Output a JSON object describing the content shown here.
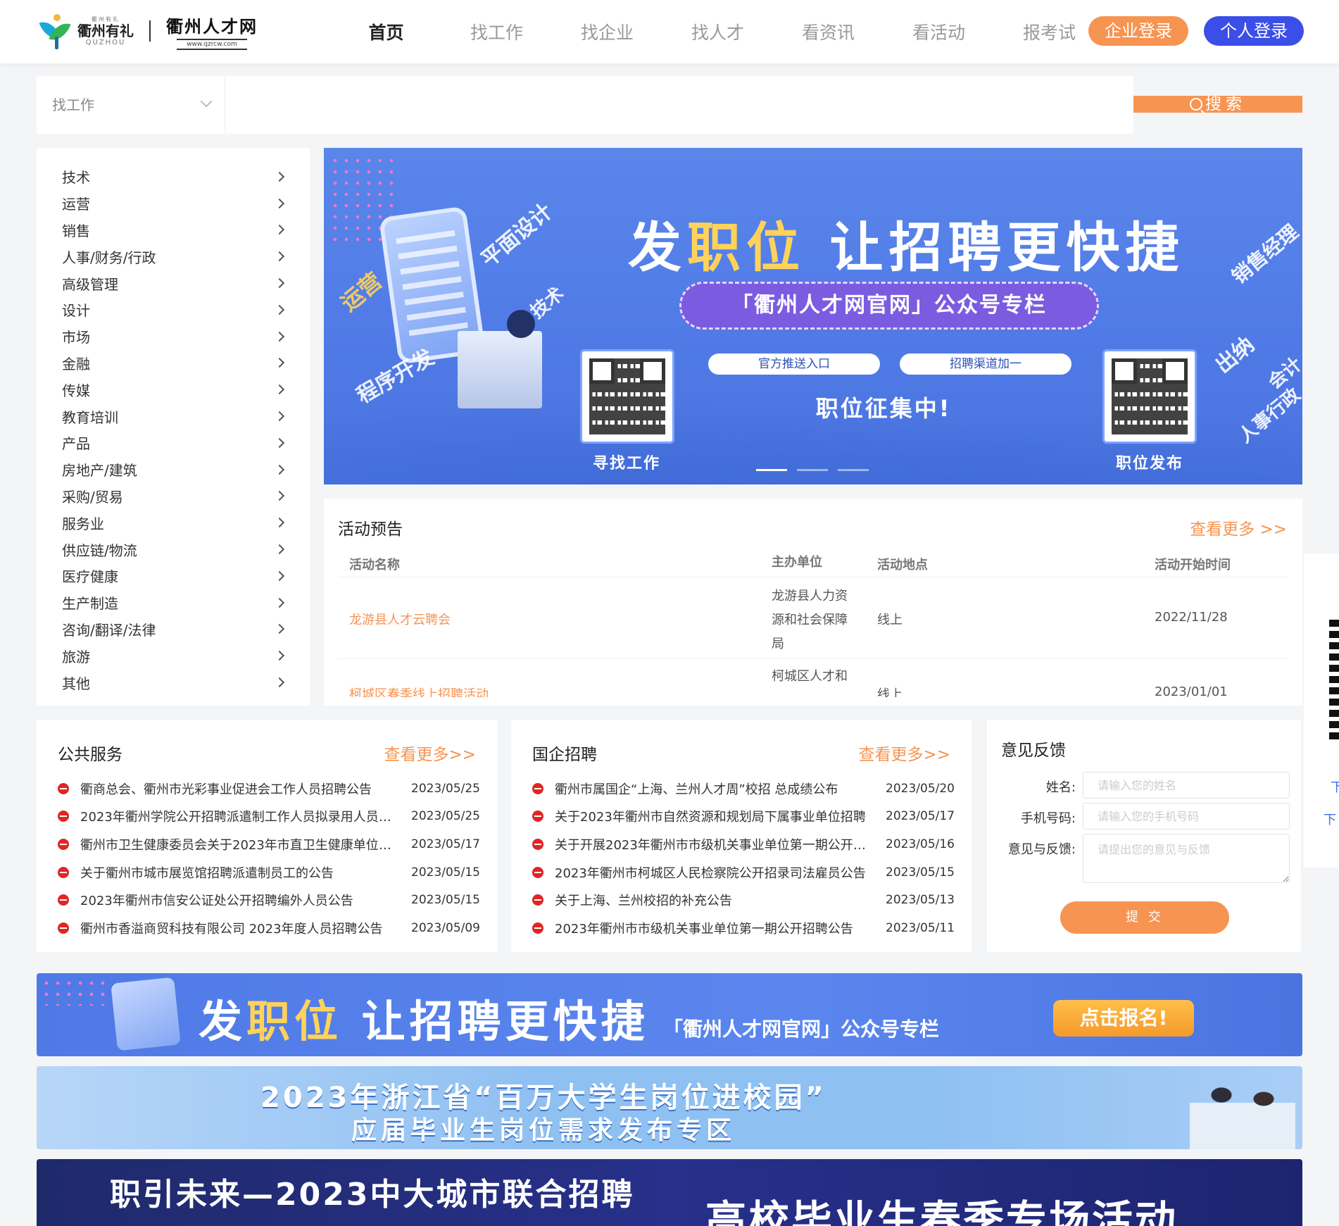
{
  "header": {
    "logo_small": "衢州有礼",
    "logo_brand": "衢州有礼",
    "logo_en": "QUZHOU",
    "site_name": "衢州人才网",
    "site_url": "www.qzrcw.com",
    "nav": [
      "首页",
      "找工作",
      "找企业",
      "找人才",
      "看资讯",
      "看活动",
      "报考试"
    ],
    "company_login": "企业登录",
    "personal_login": "个人登录"
  },
  "search": {
    "category": "找工作",
    "placeholder": "",
    "button": "搜索"
  },
  "sidebar": {
    "items": [
      "技术",
      "运营",
      "销售",
      "人事/财务/行政",
      "高级管理",
      "设计",
      "市场",
      "金融",
      "传媒",
      "教育培训",
      "产品",
      "房地产/建筑",
      "采购/贸易",
      "服务业",
      "供应链/物流",
      "医疗健康",
      "生产制造",
      "咨询/翻译/法律",
      "旅游",
      "其他"
    ]
  },
  "banner": {
    "title_pre": "发",
    "title_hl": "职位",
    "title_post": "让招聘更快捷",
    "pill": "「衢州人才网官网」公众号专栏",
    "tag1": "官方推送入口",
    "tag2": "招聘渠道加一",
    "collect": "职位征集中!",
    "qr1_label": "寻找工作",
    "qr2_label": "职位发布",
    "deco_words": [
      "平面设计",
      "运营",
      "技术",
      "程序开发",
      "销售经理",
      "出纳",
      "会计",
      "人事行政"
    ]
  },
  "activity": {
    "title": "活动预告",
    "more": "查看更多 >>",
    "headers": {
      "name": "活动名称",
      "org": "主办单位",
      "place": "活动地点",
      "time": "活动开始时间"
    },
    "rows": [
      {
        "name": "龙游县人才云聘会",
        "org": "龙游县人力资源和社会保障局",
        "place": "线上",
        "time": "2022/11/28"
      },
      {
        "name": "柯城区春季线上招聘活动",
        "org": "柯城区人才和",
        "place": "线上",
        "time": "2023/01/01"
      }
    ]
  },
  "public_service": {
    "title": "公共服务",
    "more": "查看更多>>",
    "items": [
      {
        "title": "衢商总会、衢州市光彩事业促进会工作人员招聘公告",
        "date": "2023/05/25"
      },
      {
        "title": "2023年衢州学院公开招聘派遣制工作人员拟录用人员公示",
        "date": "2023/05/25"
      },
      {
        "title": "衢州市卫生健康委员会关于2023年市直卫生健康单位公开招聘",
        "date": "2023/05/17"
      },
      {
        "title": "关于衢州市城市展览馆招聘派遣制员工的公告",
        "date": "2023/05/15"
      },
      {
        "title": "2023年衢州市信安公证处公开招聘编外人员公告",
        "date": "2023/05/15"
      },
      {
        "title": "衢州市香溢商贸科技有限公司 2023年度人员招聘公告",
        "date": "2023/05/09"
      }
    ]
  },
  "soe": {
    "title": "国企招聘",
    "more": "查看更多>>",
    "items": [
      {
        "title": "衢州市属国企“上海、兰州人才周”校招 总成绩公布",
        "date": "2023/05/20"
      },
      {
        "title": "关于2023年衢州市自然资源和规划局下属事业单位招聘",
        "date": "2023/05/17"
      },
      {
        "title": "关于开展2023年衢州市市级机关事业单位第一期公开招聘",
        "date": "2023/05/16"
      },
      {
        "title": "2023年衢州市柯城区人民检察院公开招录司法雇员公告",
        "date": "2023/05/15"
      },
      {
        "title": "关于上海、兰州校招的补充公告",
        "date": "2023/05/13"
      },
      {
        "title": "2023年衢州市市级机关事业单位第一期公开招聘公告",
        "date": "2023/05/11"
      }
    ]
  },
  "feedback": {
    "title": "意见反馈",
    "name_label": "姓名:",
    "name_placeholder": "请输入您的姓名",
    "phone_label": "手机号码:",
    "phone_placeholder": "请输入您的手机号码",
    "opinion_label": "意见与反馈:",
    "opinion_placeholder": "请提出您的意见与反馈",
    "submit": "提 交"
  },
  "float_side": {
    "text1": "下",
    "text2": "下"
  },
  "bottom_banners": {
    "b1_pre": "发",
    "b1_hl": "职位",
    "b1_post": "让招聘更快捷",
    "b1_sub": "「衢州人才网官网」公众号专栏",
    "b1_cta": "点击报名!",
    "b2_line1": "2023年浙江省“百万大学生岗位进校园”",
    "b2_line2": "应届毕业生岗位需求发布专区",
    "b3_line1": "职引未来—2023中大城市联合招聘",
    "b3_line2": "高校毕业生春季专场活动"
  },
  "colors": {
    "accent_orange": "#f79452",
    "accent_blue": "#3b4ee8",
    "banner_blue": "#4f7ae6"
  }
}
